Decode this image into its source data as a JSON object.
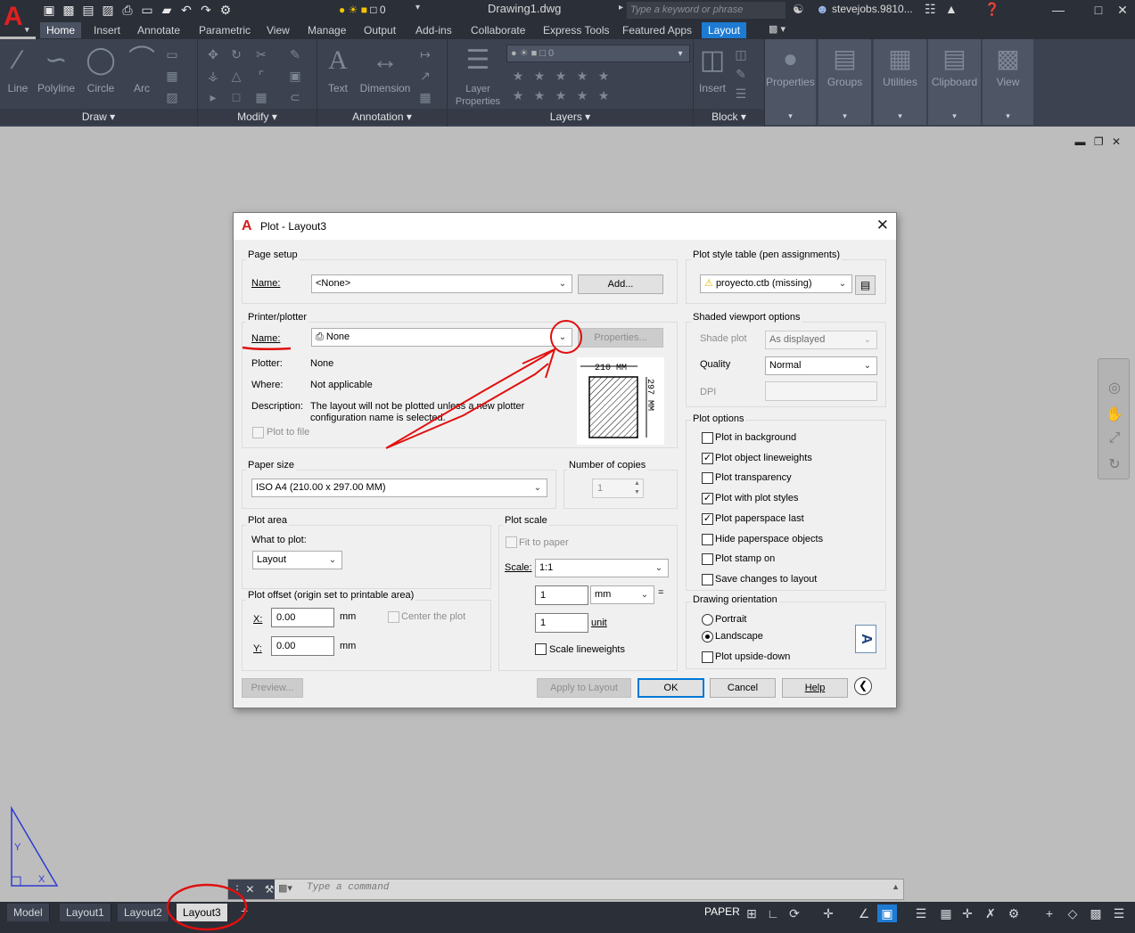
{
  "titlebar": {
    "layer_value": "0",
    "document": "Drawing1.dwg",
    "search_placeholder": "Type a keyword or phrase",
    "user": "stevejobs.9810..."
  },
  "ribbon": {
    "tabs": [
      "Home",
      "Insert",
      "Annotate",
      "Parametric",
      "View",
      "Manage",
      "Output",
      "Add-ins",
      "Collaborate",
      "Express Tools",
      "Featured Apps",
      "Layout"
    ],
    "draw": {
      "title": "Draw",
      "tools": [
        "Line",
        "Polyline",
        "Circle",
        "Arc"
      ]
    },
    "modify": {
      "title": "Modify"
    },
    "annotation": {
      "title": "Annotation",
      "tools": [
        "Text",
        "Dimension"
      ]
    },
    "layers": {
      "title": "Layers",
      "layer_properties": "Layer Properties",
      "current_layer": "0"
    },
    "block": {
      "title": "Block",
      "insert": "Insert"
    },
    "panels": [
      "Properties",
      "Groups",
      "Utilities",
      "Clipboard",
      "View"
    ]
  },
  "dialog": {
    "title": "Plot - Layout3",
    "page_setup": {
      "title": "Page setup",
      "name_label": "Name:",
      "name_value": "<None>",
      "add_button": "Add..."
    },
    "printer": {
      "title": "Printer/plotter",
      "name_label": "Name:",
      "name_value": "None",
      "properties_button": "Properties...",
      "plotter_label": "Plotter:",
      "plotter_value": "None",
      "where_label": "Where:",
      "where_value": "Not applicable",
      "description_label": "Description:",
      "description_line1": "The layout will not be plotted unless a new plotter",
      "description_line2": "configuration name is selected.",
      "plot_to_file": "Plot to file",
      "preview_width": "210 MM",
      "preview_height": "297 MM"
    },
    "paper_size": {
      "title": "Paper size",
      "value": "ISO A4 (210.00 x 297.00 MM)"
    },
    "copies": {
      "title": "Number of copies",
      "value": "1"
    },
    "plot_area": {
      "title": "Plot area",
      "what_label": "What to plot:",
      "what_value": "Layout"
    },
    "plot_offset": {
      "title": "Plot offset (origin set to printable area)",
      "x_label": "X:",
      "x_value": "0.00",
      "y_label": "Y:",
      "y_value": "0.00",
      "unit": "mm",
      "center": "Center the plot"
    },
    "plot_scale": {
      "title": "Plot scale",
      "fit": "Fit to paper",
      "scale_label": "Scale:",
      "scale_value": "1:1",
      "value1": "1",
      "unit1": "mm",
      "equals": "=",
      "value2": "1",
      "unit2": "unit",
      "scale_lineweights": "Scale lineweights"
    },
    "plot_style": {
      "title": "Plot style table (pen assignments)",
      "value": "proyecto.ctb (missing)"
    },
    "shaded": {
      "title": "Shaded viewport options",
      "shade_label": "Shade plot",
      "shade_value": "As displayed",
      "quality_label": "Quality",
      "quality_value": "Normal",
      "dpi_label": "DPI"
    },
    "plot_options": {
      "title": "Plot options",
      "items": [
        {
          "label": "Plot in background",
          "checked": false
        },
        {
          "label": "Plot object lineweights",
          "checked": true
        },
        {
          "label": "Plot transparency",
          "checked": false
        },
        {
          "label": "Plot with plot styles",
          "checked": true
        },
        {
          "label": "Plot paperspace last",
          "checked": true
        },
        {
          "label": "Hide paperspace objects",
          "checked": false
        },
        {
          "label": "Plot stamp on",
          "checked": false
        },
        {
          "label": "Save changes to layout",
          "checked": false
        }
      ]
    },
    "orientation": {
      "title": "Drawing orientation",
      "portrait": "Portrait",
      "landscape": "Landscape",
      "upside_down": "Plot upside-down",
      "selected": "Landscape"
    },
    "buttons": {
      "preview": "Preview...",
      "apply": "Apply to Layout",
      "ok": "OK",
      "cancel": "Cancel",
      "help": "Help"
    }
  },
  "command": {
    "placeholder": "Type a command"
  },
  "layout_tabs": [
    "Model",
    "Layout1",
    "Layout2",
    "Layout3"
  ],
  "active_layout_tab": "Layout3",
  "status": {
    "space": "PAPER"
  },
  "colors": {
    "annotation_red": "#e01010",
    "accent_blue": "#1e7bd4",
    "ribbon_bg": "#3c4250"
  }
}
